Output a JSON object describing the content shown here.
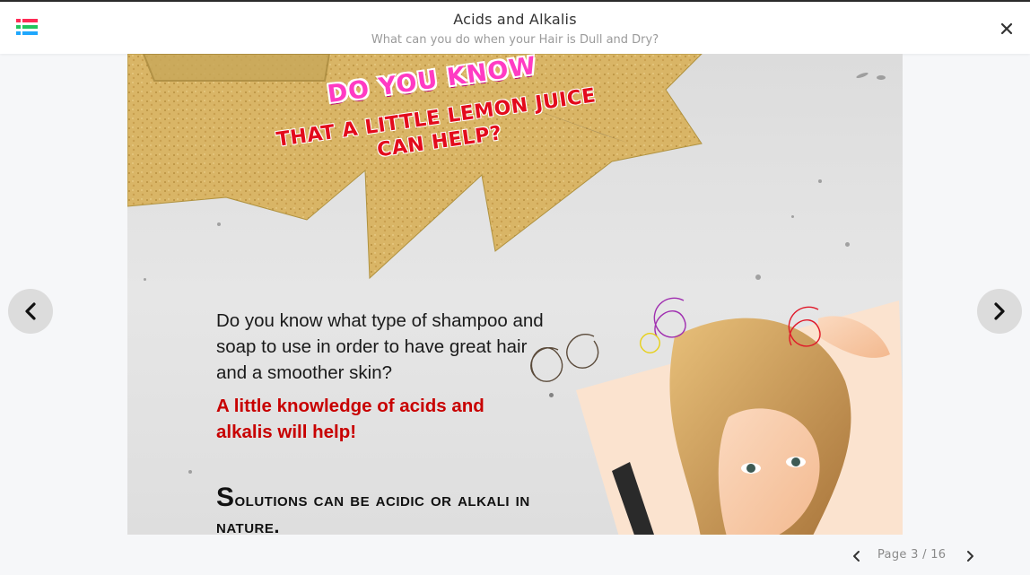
{
  "header": {
    "title": "Acids and Alkalis",
    "subtitle": "What can you do when your Hair is Dull and Dry?"
  },
  "icons": {
    "menu": "list-menu-icon",
    "close": "close-icon",
    "prev": "chevron-left-icon",
    "next": "chevron-right-icon"
  },
  "colors": {
    "menu_bars": [
      "#ff2a55",
      "#22c55e",
      "#1ea7fd"
    ],
    "accent_red": "#c80000",
    "accent_pink": "#ff3bc3"
  },
  "page": {
    "banner_line1": "DO YOU KNOW",
    "banner_line2": "THAT A LITTLE LEMON JUICE CAN HELP?",
    "body": "Do you know what type of shampoo and soap to use in order to have great hair and a smoother skin?",
    "highlight": "A little knowledge of acids and alkalis will help!",
    "solutions": "Solutions can be acidic or alkali in nature."
  },
  "pagination": {
    "label": "Page 3 / 16"
  }
}
